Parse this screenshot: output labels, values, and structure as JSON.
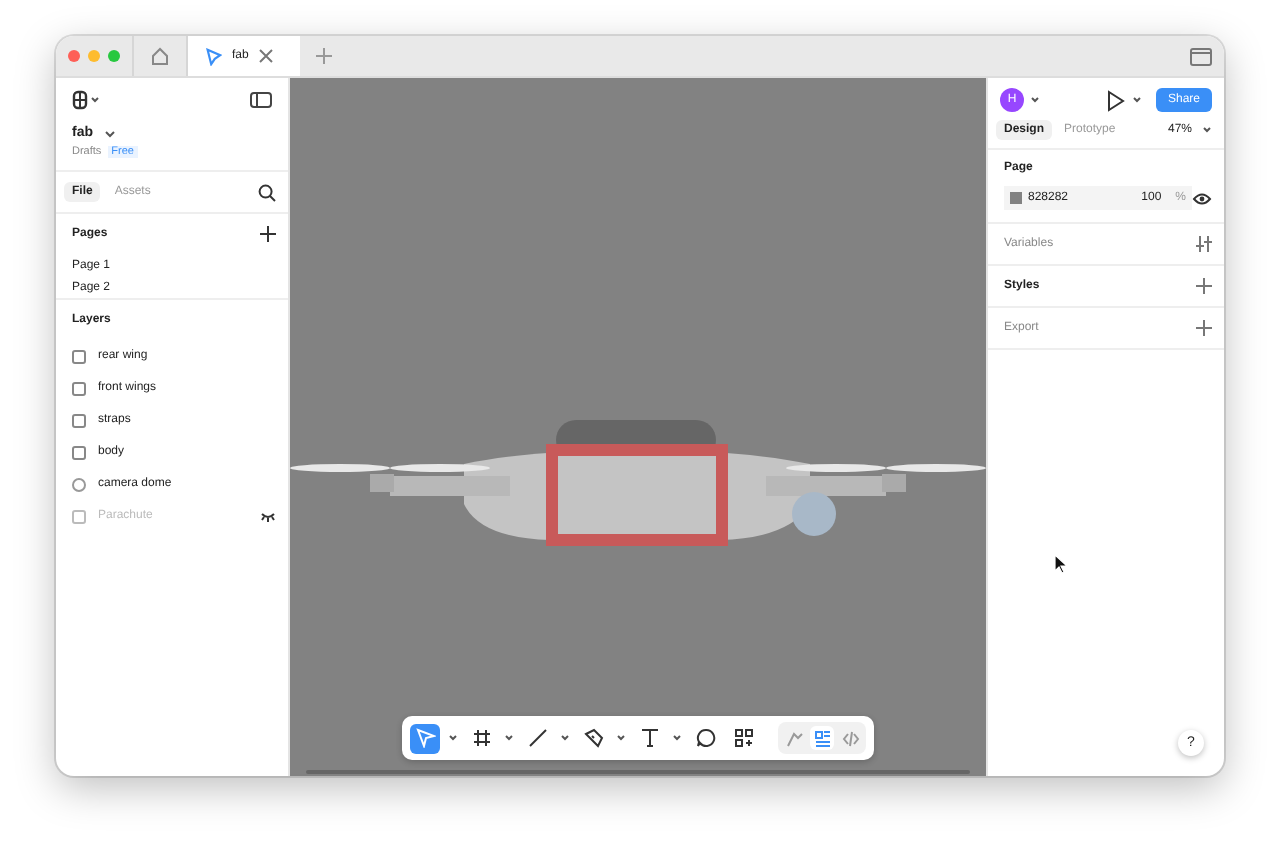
{
  "browser_tabs": [
    {
      "kind": "home",
      "selected": false
    },
    {
      "kind": "file",
      "label": "fab",
      "selected": true
    }
  ],
  "file": {
    "name": "fab",
    "location": "Drafts",
    "plan": "Free"
  },
  "panel_tabs": [
    {
      "label": "File",
      "selected": true
    },
    {
      "label": "Assets",
      "selected": false
    }
  ],
  "pages": {
    "title": "Pages",
    "items": [
      {
        "label": "Page 1"
      },
      {
        "label": "Page 2"
      }
    ]
  },
  "layers": {
    "title": "Layers",
    "items": [
      {
        "label": "rear wing",
        "kind": "frame",
        "hidden": false
      },
      {
        "label": "front wings",
        "kind": "frame",
        "hidden": false
      },
      {
        "label": "straps",
        "kind": "frame",
        "hidden": false
      },
      {
        "label": "body",
        "kind": "frame",
        "hidden": false
      },
      {
        "label": "camera dome",
        "kind": "ellipse",
        "hidden": false
      },
      {
        "label": "Parachute",
        "kind": "frame",
        "hidden": true
      }
    ]
  },
  "tools": [
    {
      "kind": "move",
      "selected": true,
      "caret": true
    },
    {
      "kind": "frame",
      "selected": false,
      "caret": true
    },
    {
      "kind": "line",
      "selected": false,
      "caret": true
    },
    {
      "kind": "pen",
      "selected": false,
      "caret": true
    },
    {
      "kind": "text",
      "selected": false,
      "caret": true
    },
    {
      "kind": "comment",
      "selected": false,
      "caret": false
    },
    {
      "kind": "actions",
      "selected": false,
      "caret": false
    }
  ],
  "modes": [
    {
      "kind": "draw",
      "selected": false
    },
    {
      "kind": "design",
      "selected": true
    },
    {
      "kind": "dev",
      "selected": false
    }
  ],
  "right": {
    "avatar": "H",
    "share": "Share",
    "tabs": [
      {
        "label": "Design",
        "selected": true
      },
      {
        "label": "Prototype",
        "selected": false
      }
    ],
    "zoom": "47%",
    "page_title": "Page",
    "fill": {
      "color": "#828282",
      "hex": "828282",
      "opacity": "100",
      "unit": "%"
    },
    "sections": [
      {
        "label": "Variables",
        "kind": "variables",
        "bold": false
      },
      {
        "label": "Styles",
        "kind": "add",
        "bold": true
      },
      {
        "label": "Export",
        "kind": "add",
        "bold": false
      }
    ],
    "help": "?"
  }
}
